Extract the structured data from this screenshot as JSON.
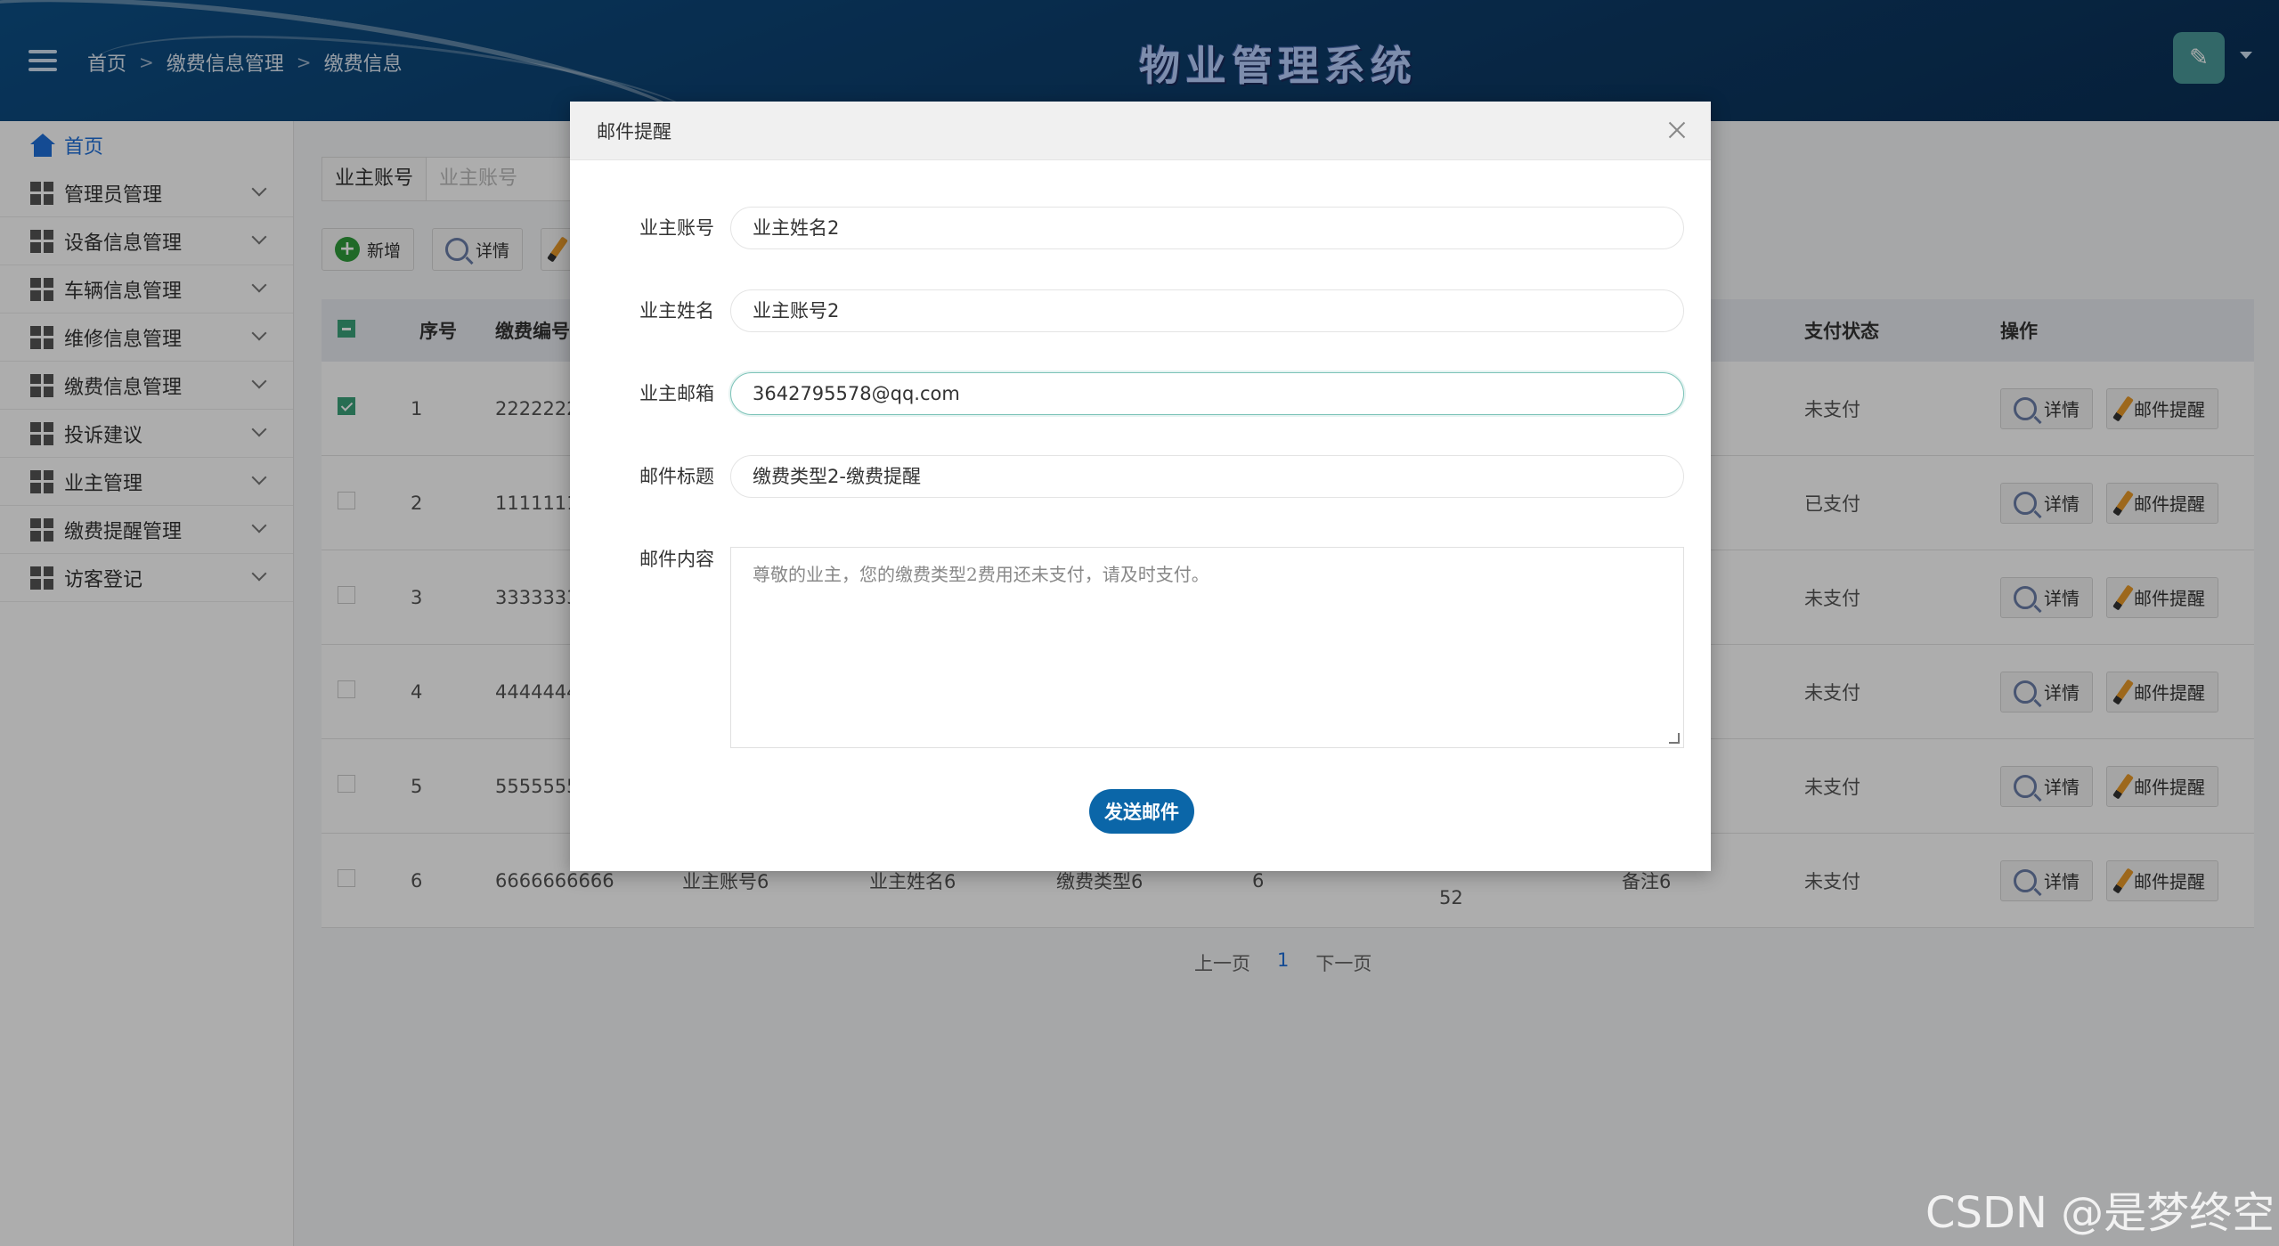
{
  "header": {
    "breadcrumb": [
      "首页",
      "缴费信息管理",
      "缴费信息"
    ],
    "system_title": "物业管理系统"
  },
  "sidebar": {
    "items": [
      {
        "label": "首页"
      },
      {
        "label": "管理员管理"
      },
      {
        "label": "设备信息管理"
      },
      {
        "label": "车辆信息管理"
      },
      {
        "label": "维修信息管理"
      },
      {
        "label": "缴费信息管理"
      },
      {
        "label": "投诉建议"
      },
      {
        "label": "业主管理"
      },
      {
        "label": "缴费提醒管理"
      },
      {
        "label": "访客登记"
      }
    ]
  },
  "search": {
    "label": "业主账号",
    "placeholder": "业主账号"
  },
  "toolbar": {
    "add_label": "新增",
    "detail_label": "详情"
  },
  "table": {
    "columns": {
      "index": "序号",
      "code": "缴费编号",
      "pay_status": "支付状态",
      "actions": "操作"
    },
    "rows": [
      {
        "index": "1",
        "code": "2222222",
        "status": "未支付"
      },
      {
        "index": "2",
        "code": "1111111",
        "status": "已支付"
      },
      {
        "index": "3",
        "code": "3333333",
        "status": "未支付"
      },
      {
        "index": "4",
        "code": "4444444",
        "status": "未支付"
      },
      {
        "index": "5",
        "code": "5555555",
        "status": "未支付"
      },
      {
        "index": "6",
        "code": "6666666666",
        "owner_account": "业主账号6",
        "owner_name": "业主姓名6",
        "fee_type": "缴费类型6",
        "amount": "6",
        "time_tail": "52",
        "remark": "备注6",
        "status": "未支付"
      }
    ],
    "row_detail_label": "详情",
    "row_mail_label": "邮件提醒"
  },
  "pager": {
    "prev": "上一页",
    "current": "1",
    "next": "下一页"
  },
  "modal": {
    "title": "邮件提醒",
    "fields": {
      "owner_account_label": "业主账号",
      "owner_account_value": "业主姓名2",
      "owner_name_label": "业主姓名",
      "owner_name_value": "业主账号2",
      "owner_email_label": "业主邮箱",
      "owner_email_value": "3642795578@qq.com",
      "mail_subject_label": "邮件标题",
      "mail_subject_value": "缴费类型2-缴费提醒",
      "mail_content_label": "邮件内容",
      "mail_content_value": "尊敬的业主，您的缴费类型2费用还未支付，请及时支付。"
    },
    "send_label": "发送邮件"
  },
  "watermark": "CSDN @是梦终空"
}
